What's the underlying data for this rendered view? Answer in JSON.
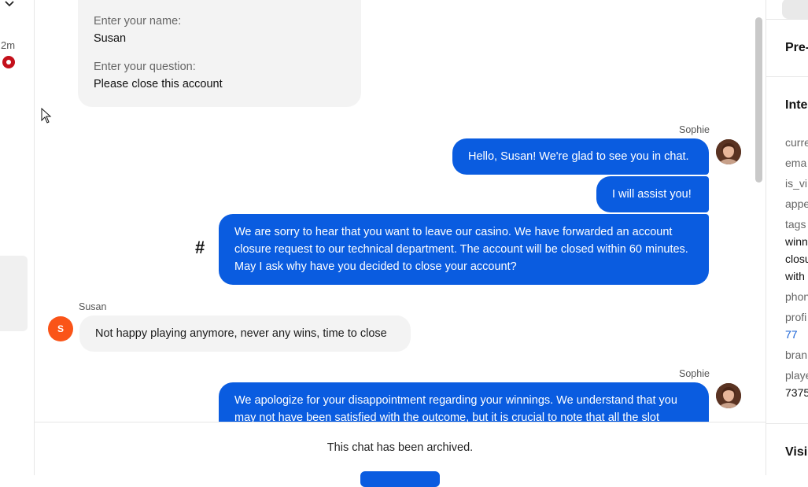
{
  "sidebar": {
    "time_ago": "2m"
  },
  "prechat": {
    "name_label": "Enter your name:",
    "name_value": "Susan",
    "question_label": "Enter your question:",
    "question_value": "Please close this account"
  },
  "messages": [
    {
      "author": "Sophie",
      "text": "Hello, Susan! We're glad to see you in chat."
    },
    {
      "text": "I will assist you!"
    },
    {
      "text": "We are sorry to hear that you want to leave our casino. We have forwarded an account closure request to our technical department. The account will be closed within 60 minutes. May I ask why have you decided to close your account?"
    },
    {
      "author": "Susan",
      "initial": "S",
      "text": "Not happy playing anymore, never any wins, time to close"
    },
    {
      "author": "Sophie",
      "text": "We apologize for your disappointment regarding your winnings. We understand that you may not have been satisfied with the outcome, but it is crucial to note that all the slot"
    }
  ],
  "hash_symbol": "#",
  "footer": {
    "archived_text": "This chat has been archived."
  },
  "right_panel": {
    "section1": "Pre-",
    "section2": "Inte",
    "fields": [
      {
        "key": "curre"
      },
      {
        "key": "ema"
      },
      {
        "key": "is_vi"
      },
      {
        "key": "appe"
      },
      {
        "key": "tags",
        "value_lines": [
          "winn",
          "closu",
          "with"
        ]
      },
      {
        "key": "phon"
      },
      {
        "key": "profi",
        "link": "77"
      },
      {
        "key": "bran"
      },
      {
        "key": "playe",
        "value": "7375"
      }
    ],
    "section3": "Visi"
  },
  "colors": {
    "agent_bubble": "#0a5ce0",
    "visitor_bubble": "#f3f3f3",
    "visitor_avatar": "#fa5418",
    "status_dot": "#c4101b"
  }
}
